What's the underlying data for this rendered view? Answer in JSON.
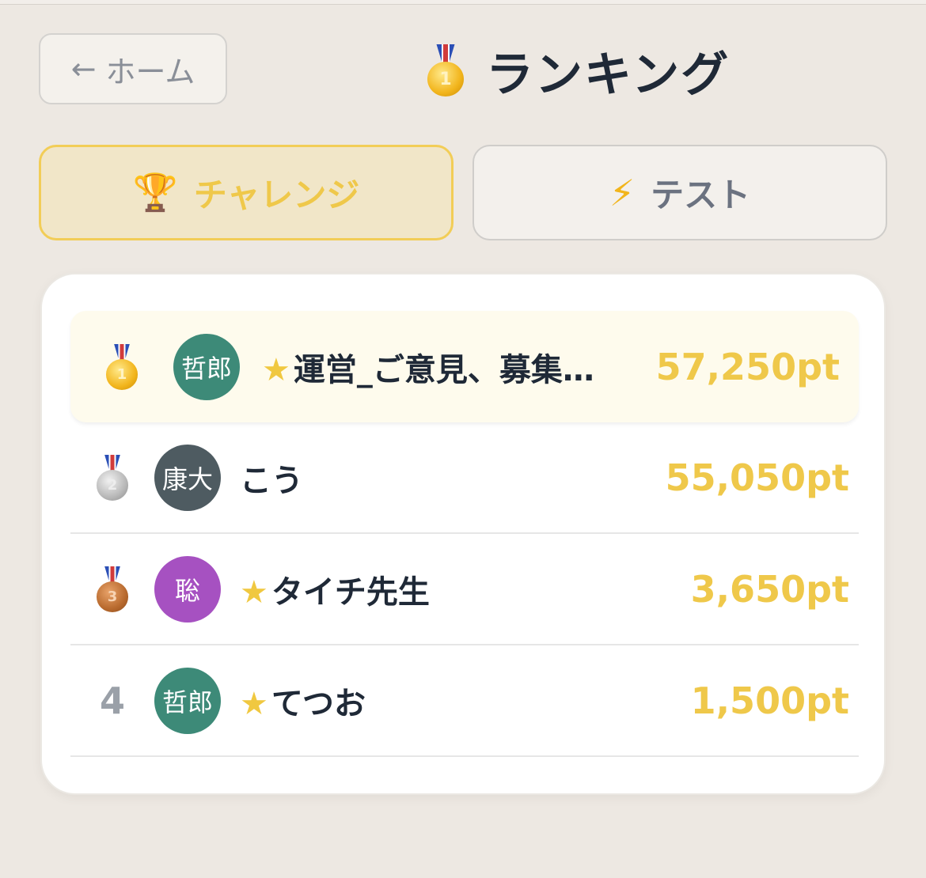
{
  "header": {
    "home_label": "ホーム",
    "title": "ランキング"
  },
  "tabs": [
    {
      "label": "チャレンジ",
      "icon": "trophy-icon",
      "active": true
    },
    {
      "label": "テスト",
      "icon": "lightning-icon",
      "active": false
    }
  ],
  "colors": {
    "accent": "#efc84a",
    "background": "#ede8e2",
    "active_tab_bg": "#f1e6c8",
    "first_row_bg": "#fefbed"
  },
  "ranking": [
    {
      "rank": "1",
      "medal": "gold-medal",
      "avatar_text": "哲郎",
      "avatar_color": "#3d8a78",
      "starred": true,
      "name": "運営_ご意見、募集…",
      "points": "57,250pt"
    },
    {
      "rank": "2",
      "medal": "silver-medal",
      "avatar_text": "康大",
      "avatar_color": "#4e5b61",
      "starred": false,
      "name": "こう",
      "points": "55,050pt"
    },
    {
      "rank": "3",
      "medal": "bronze-medal",
      "avatar_text": "聡",
      "avatar_color": "#a651c1",
      "starred": true,
      "name": "タイチ先生",
      "points": "3,650pt"
    },
    {
      "rank": "4",
      "medal": "",
      "avatar_text": "哲郎",
      "avatar_color": "#3d8a78",
      "starred": true,
      "name": "てつお",
      "points": "1,500pt"
    }
  ]
}
